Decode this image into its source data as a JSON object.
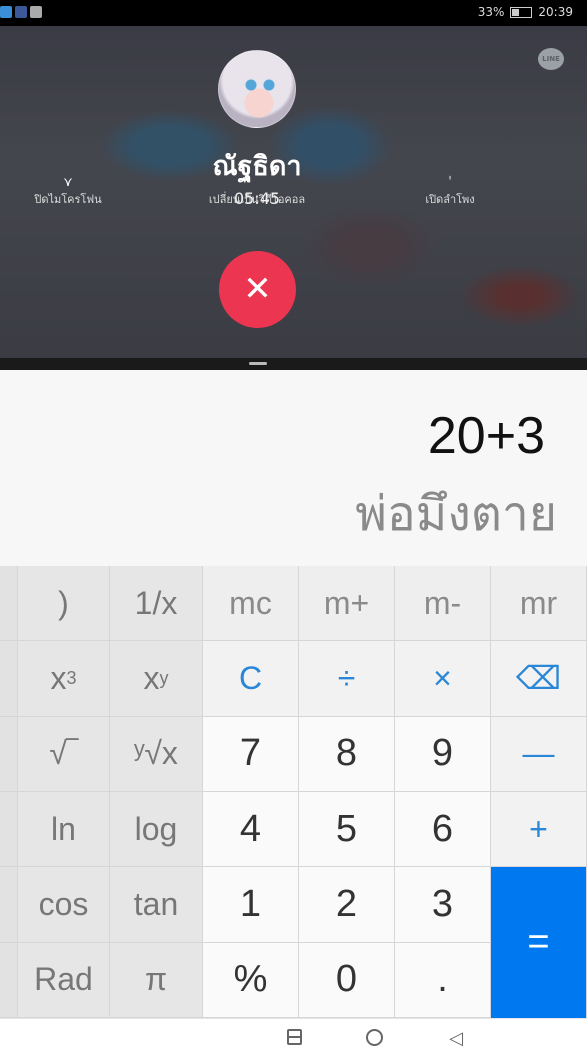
{
  "status_bar": {
    "battery": "33%",
    "time": "20:39",
    "battery_fill": 0.33
  },
  "call": {
    "app_logo_text": "LINE",
    "caller_name": "ณัฐธิดา",
    "duration": "05:45",
    "options": [
      {
        "label": "ปิดไมโครโฟน",
        "icon": "microphone-icon"
      },
      {
        "label": "เปลี่ยนเป็นวิดีโอคอล",
        "icon": "video-icon"
      },
      {
        "label": "เปิดลำโพง",
        "icon": "speaker-icon"
      }
    ],
    "end_button_glyph": "✕",
    "colors": {
      "end_button": "#ec3550"
    }
  },
  "calculator": {
    "expression": "20+3",
    "result": "พ่อมึงตาย",
    "colors": {
      "accent": "#0078f0",
      "operator": "#2a86d6"
    },
    "keys": {
      "rparen": ")",
      "reciprocal": "1/x",
      "mc": "mc",
      "mplus": "m+",
      "mminus": "m-",
      "mr": "mr",
      "cube_base": "x",
      "cube_exp": "3",
      "pow_base": "x",
      "pow_exp": "y",
      "clear": "C",
      "divide": "÷",
      "multiply": "×",
      "backspace": "⌫",
      "root": "√‾",
      "yroot": "ʸ√x",
      "n7": "7",
      "n8": "8",
      "n9": "9",
      "minus": "—",
      "ln": "ln",
      "log": "log",
      "n4": "4",
      "n5": "5",
      "n6": "6",
      "plus": "+",
      "cos": "cos",
      "tan": "tan",
      "n1": "1",
      "n2": "2",
      "n3": "3",
      "equals": "=",
      "rad": "Rad",
      "pi": "π",
      "percent": "%",
      "n0": "0",
      "dot": "."
    }
  },
  "navbar": {
    "back_glyph": "◁"
  }
}
